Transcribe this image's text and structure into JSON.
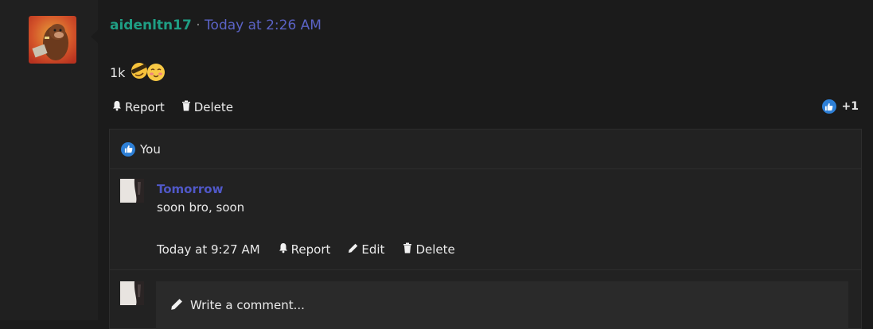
{
  "post": {
    "username": "aidenltn17",
    "separator": "·",
    "timestamp": "Today at 2:26 AM",
    "message": "1k",
    "actions": {
      "report": "Report",
      "delete": "Delete"
    },
    "reaction_count": "+1"
  },
  "likers": {
    "label": "You"
  },
  "comment": {
    "username": "Tomorrow",
    "text": "soon bro, soon",
    "timestamp": "Today at 9:27 AM",
    "actions": {
      "report": "Report",
      "edit": "Edit",
      "delete": "Delete"
    }
  },
  "composer": {
    "placeholder": "Write a comment..."
  },
  "colors": {
    "username": "#1f9e84",
    "timestamp": "#5b63c6",
    "comment_user": "#5058c8",
    "like_badge": "#2d7fd6"
  },
  "icons": [
    "bell-icon",
    "trash-icon",
    "thumbs-up-icon",
    "pencil-icon"
  ]
}
